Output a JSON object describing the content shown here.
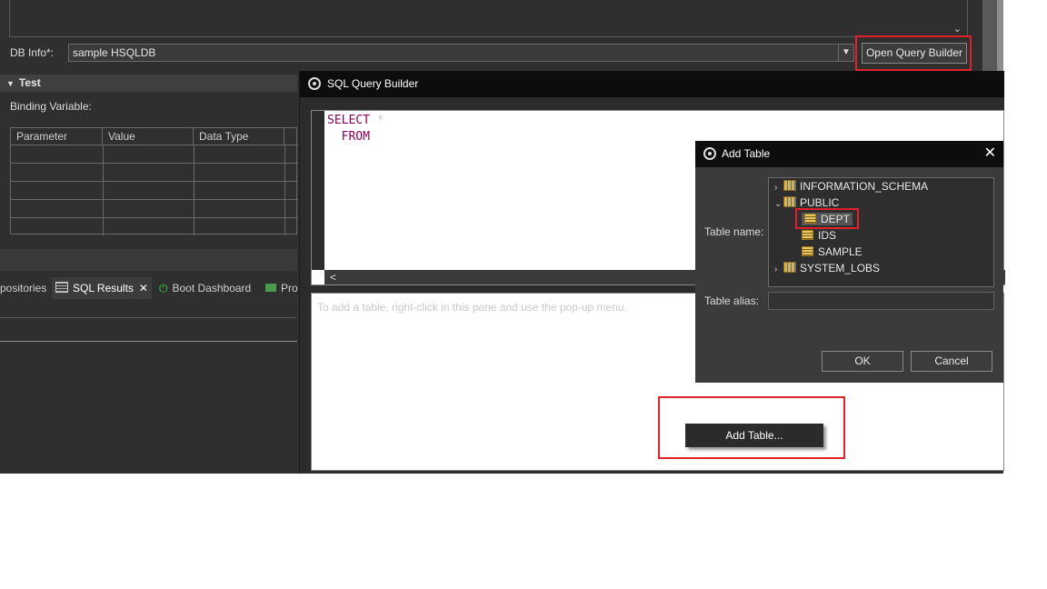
{
  "background_window": {
    "dbinfo_label": "DB Info*:",
    "dbinfo_value": "sample HSQLDB",
    "open_query_builder": "Open Query Builder",
    "test_section": "Test",
    "binding_variable_label": "Binding Variable:",
    "table_headers": [
      "Parameter",
      "Value",
      "Data Type"
    ],
    "tabs": [
      "positories",
      "SQL Results",
      "Boot Dashboard",
      "Pro"
    ]
  },
  "query_builder": {
    "title": "SQL Query Builder",
    "sql_line1": "SELECT",
    "sql_dot": "*",
    "sql_line2": "  FROM",
    "scroll_left": "<",
    "diagram_hint": "To add a table, right-click in this pane and use the pop-up menu.",
    "context_menu_item": "Add Table..."
  },
  "add_table_dialog": {
    "title": "Add Table",
    "close": "✕",
    "table_name_label": "Table name:",
    "table_alias_label": "Table alias:",
    "tree": {
      "schema1": "INFORMATION_SCHEMA",
      "schema2": "PUBLIC",
      "table1": "DEPT",
      "table2": "IDS",
      "table3": "SAMPLE",
      "schema3": "SYSTEM_LOBS"
    },
    "ok": "OK",
    "cancel": "Cancel"
  },
  "colors": {
    "highlight": "#e0202a",
    "sql_keyword": "#8b0057",
    "dark_bg": "#2f2f2f"
  }
}
